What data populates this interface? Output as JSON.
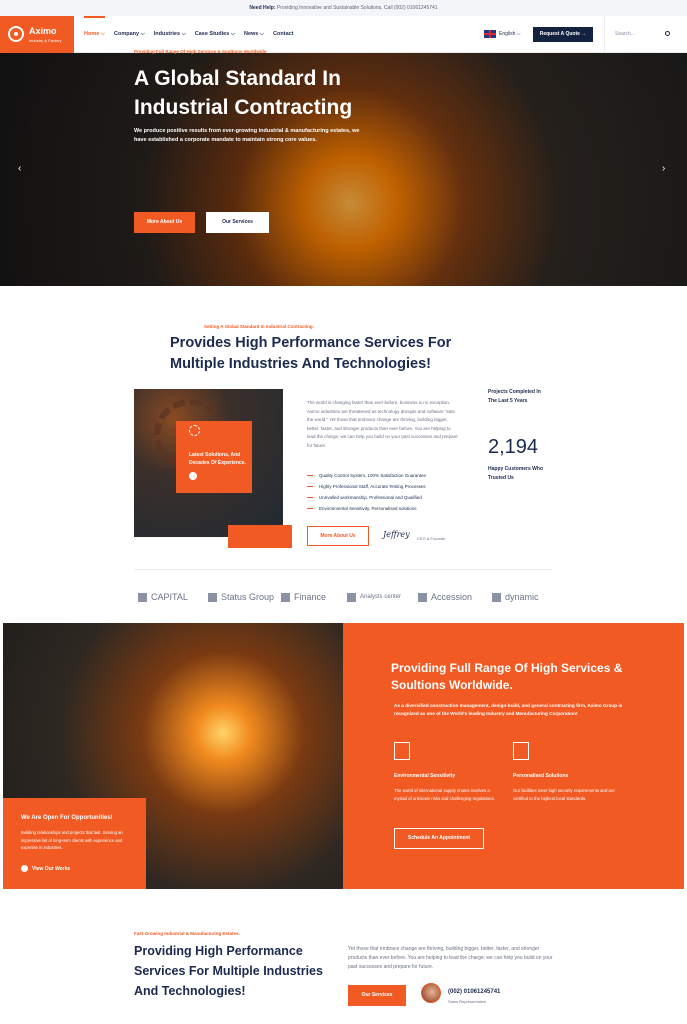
{
  "topbar": {
    "need_help": "Need Help:",
    "message": "Providing Innovative and Sustainable Solutions, Call (002) 01061245741"
  },
  "logo": {
    "name": "Aximo",
    "tagline": "Industry & Factory"
  },
  "nav": {
    "items": [
      "Home",
      "Company",
      "Industries",
      "Case Studies",
      "News",
      "Contact"
    ],
    "active": "Home"
  },
  "header": {
    "language": "English",
    "quote_button": "Request A Quote",
    "search_placeholder": "Search..."
  },
  "hero": {
    "eyebrow": "Providing Full Range Of High Services & Soultions Worldwide",
    "title": "A Global Standard In Industrial Contracting",
    "text": "We produce positive results from ever-growing industrial & manufacturing estates, we have established a corporate mandate to maintain strong core values.",
    "btn_about": "More About Us",
    "btn_services": "Our Services"
  },
  "about": {
    "eyebrow": "Setting A Global Standard In Industrial Contracting.",
    "title": "Provides High Performance Services For Multiple Industries And Technologies!",
    "card_title": "Latest Solutions, And Decades Of Experience.",
    "text": "The world is changing faster than ever before, business is no exception. Aximo industries are threatened as technology disrupts and software \"eats the world.\" Yet those that embrace change are thriving, building bigger, better, faster, and stronger products than ever before. You are helping to lead the charge; we can help you build on your past successes and prepare for future.",
    "list": [
      "Quality Control System, 100% Satisfaction Guarantee",
      "Highly Professional Staff, Accurate Testing Processes",
      "Unrivalled workmanship, Professional and Qualified",
      "Environmental Sensitivity, Personalised solutions"
    ],
    "btn": "More About Us",
    "signature": "Jeffrey",
    "signature_role": "CEO & Founder",
    "stat1_label": "Projects Completed In The Last 5 Years",
    "stat2_number": "2,194",
    "stat2_label": "Happy Customers Who Trusted Us"
  },
  "partners": [
    "CAPITAL",
    "Status Group",
    "Finance",
    "Analysts center",
    "Accession",
    "dynamic"
  ],
  "services": {
    "title": "Providing Full Range Of High Services & Soultions Worldwide.",
    "text": "As a diversified construction management, design-build, and general contracting firm, Aximo Group is recognized as one of the World's leading Industry and Manufacturing Corporation!",
    "feature1_title": "Environmental Sensitivity",
    "feature1_text": "The world of international supply chains involves a myriad of unknown risks and challenging regulations.",
    "feature2_title": "Personalised Solutions",
    "feature2_text": "Our facilities meet high security requirements and are certified to the highest local standards.",
    "btn": "Schedule An Appointment",
    "open_title": "We Are Open For Opportunities!",
    "open_text": "Building relationships and projects that last. Serving an impressive list of long-term clients with experience and expertise in industries.",
    "open_link": "View Our Works"
  },
  "bottom": {
    "eyebrow": "Fast-Growing Industrial & Manufacturing Estates.",
    "title": "Providing High Performance Services For Multiple Industries And Technologies!",
    "text": "Yet those that embrace change are thriving, building bigger, better, faster, and stronger products than ever before. You are helping to lead the charge; we can help you build on your past successes and prepare for future.",
    "btn": "Our Services",
    "phone": "(002) 01061245741",
    "phone_role": "Sales Representative"
  }
}
